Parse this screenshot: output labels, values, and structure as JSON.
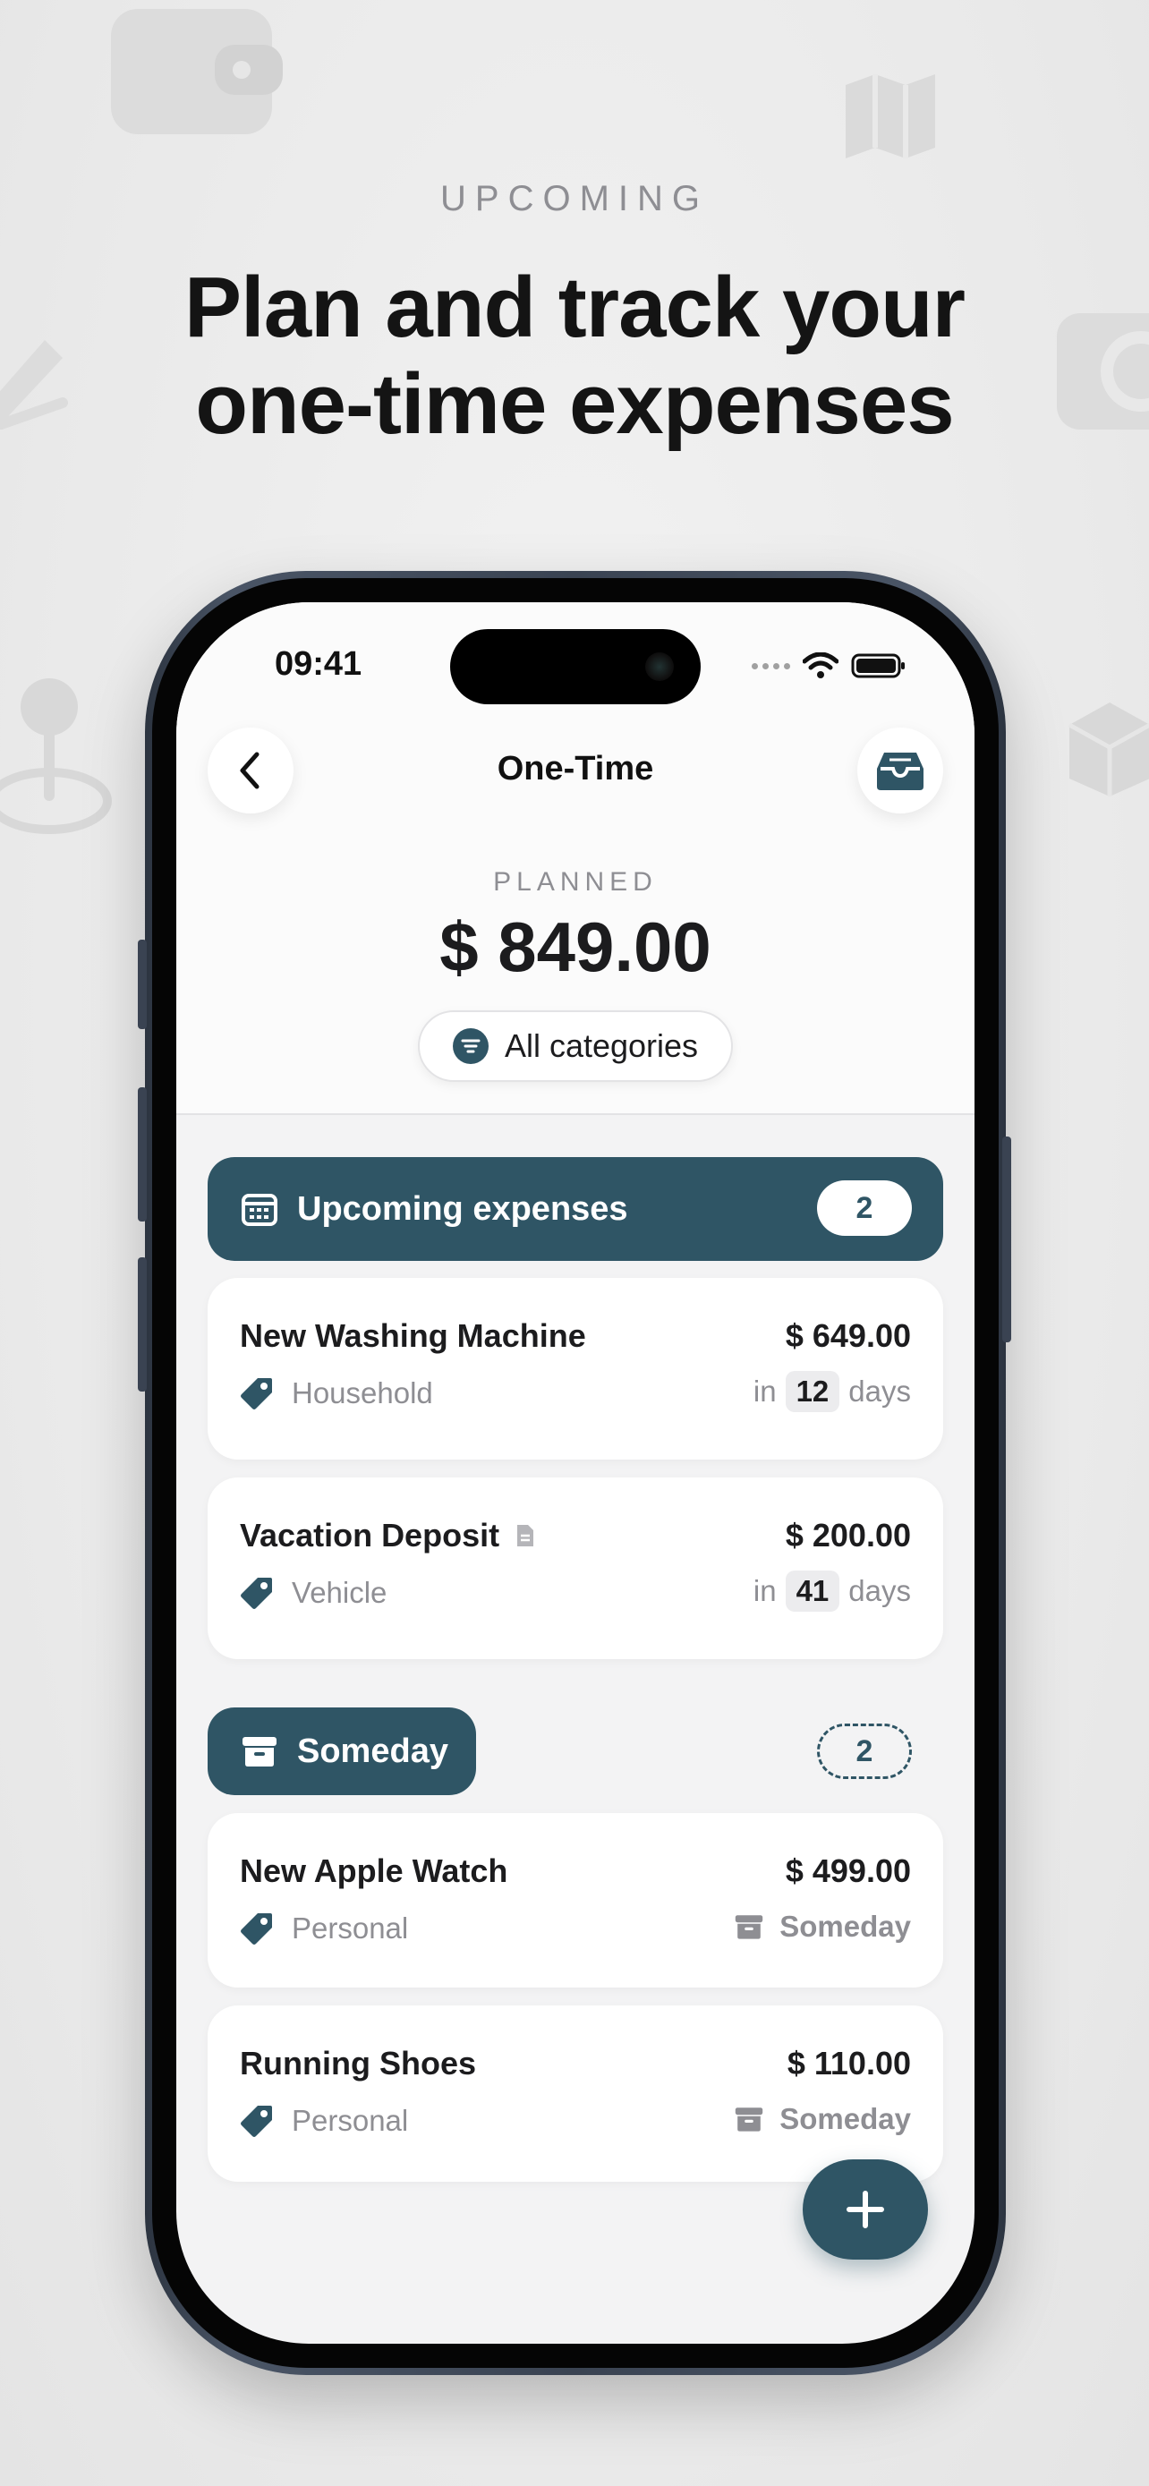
{
  "marketing": {
    "eyebrow": "UPCOMING",
    "headline_line1": "Plan and track your",
    "headline_line2": "one-time expenses"
  },
  "status_bar": {
    "time": "09:41"
  },
  "nav": {
    "title": "One-Time",
    "back_icon": "chevron-left-icon",
    "archive_icon": "archive-tray-icon"
  },
  "summary": {
    "label": "PLANNED",
    "amount": "$ 849.00",
    "filter_label": "All categories"
  },
  "upcoming": {
    "title": "Upcoming expenses",
    "count": "2",
    "items": [
      {
        "name": "New Washing Machine",
        "amount": "$ 649.00",
        "category": "Household",
        "due_prefix": "in",
        "due_days": "12",
        "due_suffix": "days",
        "has_note": false
      },
      {
        "name": "Vacation Deposit",
        "amount": "$ 200.00",
        "category": "Vehicle",
        "due_prefix": "in",
        "due_days": "41",
        "due_suffix": "days",
        "has_note": true
      }
    ]
  },
  "someday": {
    "title": "Someday",
    "count": "2",
    "items": [
      {
        "name": "New Apple Watch",
        "amount": "$ 499.00",
        "category": "Personal",
        "status": "Someday"
      },
      {
        "name": "Running Shoes",
        "amount": "$ 110.00",
        "category": "Personal",
        "status": "Someday"
      }
    ]
  },
  "colors": {
    "accent": "#2f5565",
    "background": "#f3f3f4",
    "card": "#ffffff",
    "muted_text": "#8e8e93"
  }
}
